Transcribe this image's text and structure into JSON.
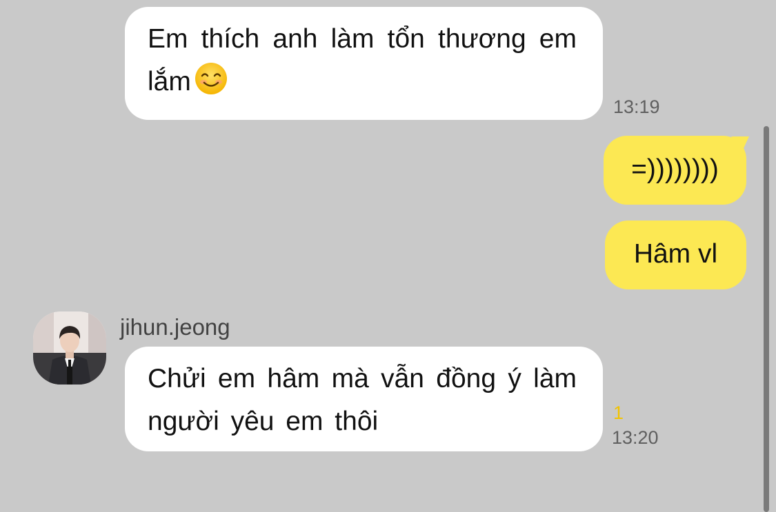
{
  "messages": [
    {
      "text_before_emoji": "Em thích anh làm tổn thương em lắm",
      "emoji": "smiling-face-icon",
      "time": "13:19"
    },
    {
      "text": "=))))))))"
    },
    {
      "text": "Hâm vl"
    },
    {
      "sender": "jihun.jeong",
      "text": "Chửi em hâm mà vẫn đồng ý làm người yêu em thôi",
      "unread": "1",
      "time": "13:20"
    }
  ],
  "colors": {
    "background": "#c9c9c9",
    "incoming_bubble": "#ffffff",
    "outgoing_bubble": "#fce853",
    "unread_count": "#f2c300"
  }
}
